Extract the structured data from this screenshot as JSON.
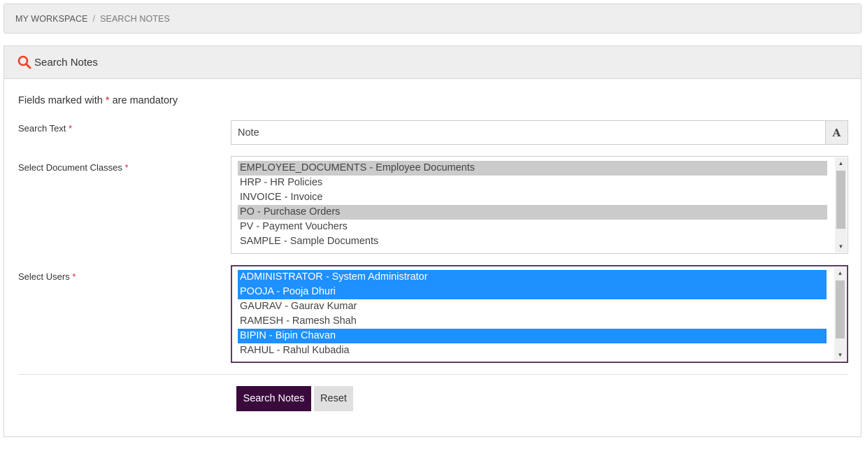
{
  "breadcrumb": {
    "items": [
      "MY WORKSPACE",
      "SEARCH NOTES"
    ],
    "separator": "/"
  },
  "panel": {
    "title": "Search Notes",
    "icon": "search-icon",
    "icon_color": "#e8452c"
  },
  "form": {
    "mandatory_note_prefix": "Fields marked with ",
    "mandatory_star": "*",
    "mandatory_note_suffix": " are mandatory",
    "search_text": {
      "label": "Search Text",
      "value": "Note",
      "addon_icon": "font-icon",
      "addon_glyph": "A"
    },
    "document_classes": {
      "label": "Select Document Classes",
      "options": [
        {
          "text": "EMPLOYEE_DOCUMENTS - Employee Documents",
          "selected": true
        },
        {
          "text": "HRP - HR Policies",
          "selected": false
        },
        {
          "text": "INVOICE - Invoice",
          "selected": false
        },
        {
          "text": "PO - Purchase Orders",
          "selected": true
        },
        {
          "text": "PV - Payment Vouchers",
          "selected": false
        },
        {
          "text": "SAMPLE - Sample Documents",
          "selected": false
        }
      ]
    },
    "users": {
      "label": "Select Users",
      "options": [
        {
          "text": "ADMINISTRATOR - System Administrator",
          "selected": true
        },
        {
          "text": "POOJA - Pooja Dhuri",
          "selected": true
        },
        {
          "text": "GAURAV - Gaurav Kumar",
          "selected": false
        },
        {
          "text": "RAMESH - Ramesh Shah",
          "selected": false
        },
        {
          "text": "BIPIN - Bipin Chavan",
          "selected": true
        },
        {
          "text": "RAHUL - Rahul Kubadia",
          "selected": false
        }
      ]
    },
    "buttons": {
      "submit_label": "Search Notes",
      "reset_label": "Reset"
    }
  },
  "colors": {
    "required": "#d9232d",
    "primary_button": "#3a0a3c",
    "selected_focused": "#1e90ff",
    "selected_unfocused": "#cbcbcb"
  }
}
